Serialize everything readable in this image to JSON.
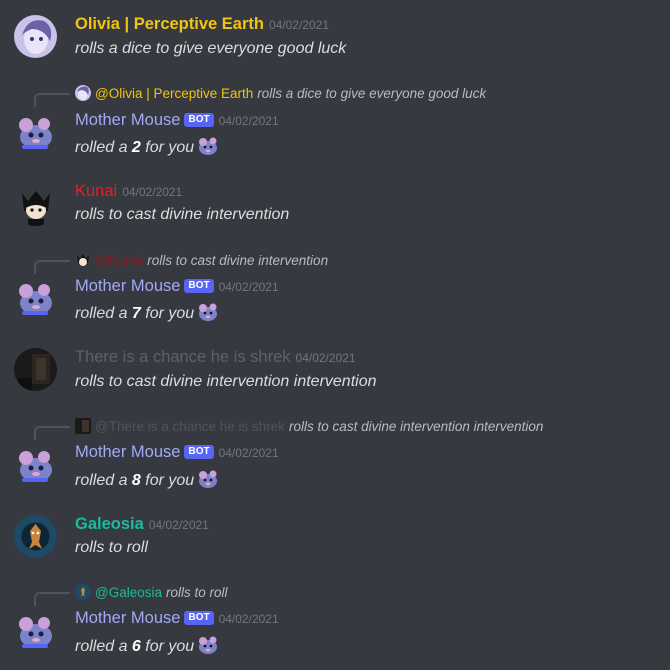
{
  "colors": {
    "olivia": "#f1c40f",
    "mother_mouse": "#a4a9f5",
    "kunai": "#ed1c24",
    "shrek": "#4f545c",
    "galeosia": "#1abc9c",
    "bot_tag_bg": "#5865f2",
    "background": "#36393f"
  },
  "messages": [
    {
      "author": "Olivia | Perceptive Earth",
      "timestamp": "04/02/2021",
      "text": "rolls a dice to give everyone good luck",
      "avatar_icon": "olivia-avatar-icon"
    },
    {
      "reply": {
        "mention": "@Olivia | Perceptive Earth",
        "text": "rolls a dice to give everyone good luck"
      },
      "author": "Mother Mouse",
      "bot_tag": "BOT",
      "timestamp": "04/02/2021",
      "text_pre": "rolled a ",
      "roll": "2",
      "text_post": " for you",
      "avatar_icon": "mother-mouse-avatar-icon"
    },
    {
      "author": "Kunai",
      "timestamp": "04/02/2021",
      "text": "rolls to cast divine intervention",
      "avatar_icon": "kunai-avatar-icon"
    },
    {
      "reply": {
        "mention": "@Kunai",
        "text": "rolls to cast divine intervention"
      },
      "author": "Mother Mouse",
      "bot_tag": "BOT",
      "timestamp": "04/02/2021",
      "text_pre": "rolled a ",
      "roll": "7",
      "text_post": " for you",
      "avatar_icon": "mother-mouse-avatar-icon"
    },
    {
      "author": "There is a chance he is shrek",
      "timestamp": "04/02/2021",
      "text": "rolls to cast divine intervention intervention",
      "avatar_icon": "shrek-avatar-icon"
    },
    {
      "reply": {
        "mention": "@There is a chance he is shrek",
        "text": "rolls to cast divine intervention intervention"
      },
      "author": "Mother Mouse",
      "bot_tag": "BOT",
      "timestamp": "04/02/2021",
      "text_pre": "rolled a ",
      "roll": "8",
      "text_post": " for you",
      "avatar_icon": "mother-mouse-avatar-icon"
    },
    {
      "author": "Galeosia",
      "timestamp": "04/02/2021",
      "text": "rolls to roll",
      "avatar_icon": "galeosia-avatar-icon"
    },
    {
      "reply": {
        "mention": "@Galeosia",
        "text": "rolls to roll"
      },
      "author": "Mother Mouse",
      "bot_tag": "BOT",
      "timestamp": "04/02/2021",
      "text_pre": "rolled a ",
      "roll": "6",
      "text_post": " for you",
      "avatar_icon": "mother-mouse-avatar-icon"
    }
  ]
}
